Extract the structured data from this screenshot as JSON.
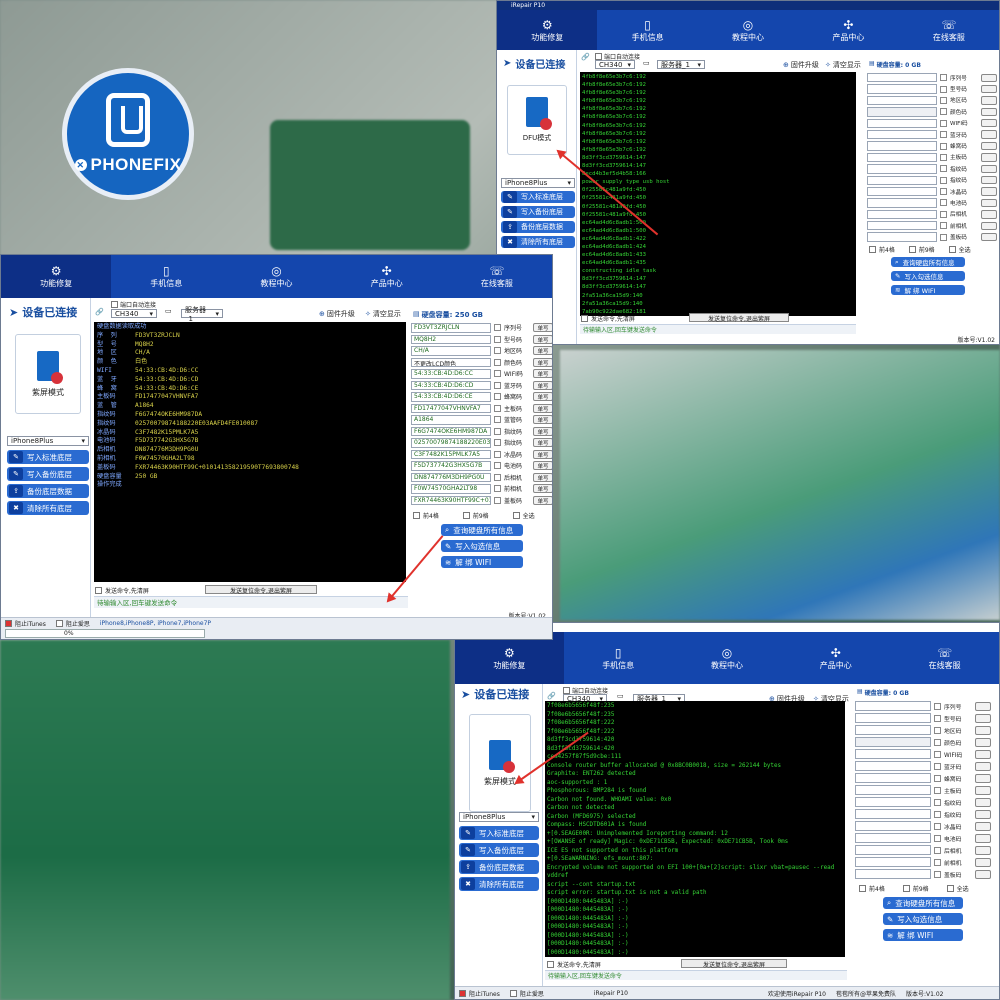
{
  "brand": {
    "logo_text": "PHONEFIX"
  },
  "colors": {
    "nav": "#1446ad",
    "console_text": "#35d435",
    "arrow": "#e0322c"
  },
  "win1": {
    "title": "iRepair P10",
    "nav": [
      "功能修复",
      "手机信息",
      "教程中心",
      "产品中心",
      "在线客服"
    ],
    "connected": "设备已连接",
    "auto_connect": "端口自动连接",
    "port": "CH340",
    "server": "服务器_1",
    "firmware_upgrade": "固件升级",
    "clear_display": "清空显示",
    "disk": "硬盘容量: 0 GB",
    "mode_label": "DFU模式",
    "model": "iPhone8Plus",
    "buttons": [
      "写入标准底层",
      "写入备份底层",
      "备份底层数据",
      "清除所有底层"
    ],
    "console": [
      "4fb8f8e65e3b7c6:192",
      "4fb8f8e65e3b7c6:192",
      "4fb8f8e65e3b7c6:192",
      "4fb8f8e65e3b7c6:192",
      "4fb8f8e65e3b7c6:192",
      "4fb8f8e65e3b7c6:192",
      "4fb8f8e65e3b7c6:192",
      "4fb8f8e65e3b7c6:192",
      "4fb8f8e65e3b7c6:192",
      "4fb8f8e65e3b7c6:192",
      "8d3ff3cd3759614:147",
      "8d3ff3cd3759614:147",
      "8ecd4b3ef5d4b58:166",
      "power supply type usb host",
      "0f25581c481a9fd:450",
      "0f25581c481a9fd:450",
      "0f25581c481a9fd:450",
      "0f25581c481a9fd:450",
      "ec64ad4d6c8adb1:500",
      "ec64ad4d6c8adb1:500",
      "ec64ad4d6c8adb1:422",
      "ec64ad4d6c8adb1:424",
      "ec64ad4d6c8adb1:433",
      "ec64ad4d6c8adb1:435",
      "constructing idle task",
      "8d3ff3cd3759614:147",
      "8d3ff3cd3759614:147",
      "2fa51a36ca15d9:140",
      "2fa51a36ca15d9:140",
      "7ab90c922dae682:181"
    ],
    "send_option": "发送命令,先清屏",
    "send_btn": "发送复位命令,退出紫屏",
    "status": "待输输入区,回车键发送命令",
    "right_labels": [
      "序列号",
      "型号码",
      "地区码",
      "颜色码",
      "WIFI码",
      "蓝牙码",
      "蜂窝码",
      "主板码",
      "指纹码",
      "指纹码",
      "冰晶码",
      "电池码",
      "后相机",
      "前相机",
      "盖板码"
    ],
    "opts": [
      "前4格",
      "前9格",
      "全选"
    ],
    "big_buttons": [
      "查询硬盘所有信息",
      "写入勾选信息",
      "解 绑 WIFI"
    ],
    "version": "版本号:V1.02"
  },
  "win2": {
    "nav": [
      "功能修复",
      "手机信息",
      "教程中心",
      "产品中心",
      "在线客服"
    ],
    "connected": "设备已连接",
    "auto_connect": "端口自动连接",
    "port": "CH340",
    "server": "服务器_1",
    "firmware_upgrade": "固件升级",
    "clear_display": "清空显示",
    "disk": "硬盘容量: 250 GB",
    "mode_label": "紫屏模式",
    "model": "iPhone8Plus",
    "buttons": [
      "写入标准底层",
      "写入备份底层",
      "备份底层数据",
      "清除所有底层"
    ],
    "console_head": "硬盘数据读取成功",
    "info_keys": [
      "序  列",
      "型  号",
      "地  区",
      "颜  色",
      "WIFI",
      "蓝  牙",
      "蜂  窝",
      "主板码",
      "蓝  管",
      "指纹码",
      "指纹码",
      "冰晶码",
      "电池码",
      "后相机",
      "前相机",
      "盖板码",
      "硬盘容量"
    ],
    "info_vals": [
      "FD3VT3ZRJCLN",
      "MQ8H2",
      "CH/A",
      "白色",
      "54:33:CB:4D:D6:CC",
      "54:33:CB:4D:D6:CD",
      "54:33:CB:4D:D6:CE",
      "FD17477047VHNVFA7",
      "A1864",
      "F6G7474OKE6HM987DA",
      "02570079874188220E03AAFD4FE010087",
      "C3F7482K15PMLK7A5",
      "F5D737742G3HX5G7B",
      "DN874776M3DH9PG0U",
      "F0W74570GHA2LT98",
      "FXR74463K90HTF99C+010141358219590T7693800748",
      "250 GB"
    ],
    "console_foot": "操作完成",
    "right_vals": [
      "FD3VT3ZRJCLN",
      "MQ8H2",
      "CH/A",
      "不更改LCD颜色",
      "54:33:CB:4D:D6:CC",
      "54:33:CB:4D:D6:CD",
      "54:33:CB:4D:D6:CE",
      "FD17477047VHNVFA7",
      "A1864",
      "F6G7474OKE6HM987DA",
      "02570079874188220E03AA",
      "C3F7482K15PMLK7A5",
      "F5D737742G3HX5G7B",
      "DN874776M3DH9PG0U",
      "F0W74570GHA2LT98",
      "FXR74463K90HTF99C+01C"
    ],
    "right_labels": [
      "序列号",
      "型号码",
      "地区码",
      "颜色码",
      "WIFI码",
      "蓝牙码",
      "蜂窝码",
      "主板码",
      "蓝管码",
      "指纹码",
      "指纹码",
      "冰晶码",
      "电池码",
      "后相机",
      "前相机",
      "盖板码"
    ],
    "write_btn": "单写",
    "opts": [
      "前4格",
      "前9格",
      "全选"
    ],
    "big_buttons": [
      "查询硬盘所有信息",
      "写入勾选信息",
      "解 绑 WIFI"
    ],
    "send_option": "发送命令,先清屏",
    "send_btn": "发送复位命令,退出紫屏",
    "status": "待输输入区,回车键发送命令",
    "version": "版本号:V1.02",
    "bottom": {
      "itunes": "阻止iTunes",
      "anti": "阻止爱思",
      "models": "iPhone8,iPhone8P, iPhone7,iPhone7P",
      "progress": "0%"
    }
  },
  "win3": {
    "nav": [
      "功能修复",
      "手机信息",
      "教程中心",
      "产品中心",
      "在线客服"
    ],
    "connected": "设备已连接",
    "auto_connect": "端口自动连接",
    "port": "CH340",
    "server": "服务器_1",
    "firmware_upgrade": "固件升级",
    "clear_display": "清空显示",
    "disk": "硬盘容量: 0 GB",
    "mode_label": "紫屏模式",
    "model": "iPhone8Plus",
    "buttons": [
      "写入标准底层",
      "写入备份底层",
      "备份底层数据",
      "清除所有底层"
    ],
    "console": [
      "7f08e6b5656f48f:235",
      "7f08e6b5656f48f:235",
      "7f08e6b5656f48f:222",
      "7f08e6b5656f48f:222",
      "8d3ff3cd3759614:420",
      "8d3ff3cd3759614:420",
      "cea4257f87f5d9cbe:111",
      "Console router buffer allocated @ 0x8BC0B0018, size = 262144 bytes",
      "Graphite: ENT262 detected",
      "aoc-supported : 1",
      "Phosphorous: BMP284 is found",
      "Carbon not found. WHOAMI value: 0x0",
      "Carbon not detected",
      "Carbon (MFD6975) selected",
      "Compass: HSCDTD601A is found",
      "+[0.SEAGE00R: Unimplemented Ioreporting command: 12",
      "+[OWANSE of ready] Magic: 0xDE71CB5B, Expected: 0xDE71CB5B, Took 0ms",
      "ICE ES not supported on this platform",
      "+[0.SEaWARNING: efs_mount:807:",
      "Encrypted volume not supported on EFI 100+[0a+[2]script: slixr vbat=pausec --read",
      "vddref",
      "script --cont startup.txt",
      "script error: startup.txt is not a valid path",
      "[000D1480:0445483A] :-)",
      "[000D1480:0445483A] :-)",
      "[000D1480:0445483A] :-)",
      "[000D1480:0445483A] :-)",
      "[000D1480:0445483A] :-)",
      "[000D1480:0445483A] :-)",
      "[000D1480:0445483A] :-)"
    ],
    "send_option": "发送命令,先清屏",
    "send_btn": "发送复位命令,退出紫屏",
    "status": "待输输入区,回车键发送命令",
    "right_labels": [
      "序列号",
      "型号码",
      "地区码",
      "颜色码",
      "WIFI码",
      "蓝牙码",
      "蜂窝码",
      "主板码",
      "指纹码",
      "指纹码",
      "冰晶码",
      "电池码",
      "后相机",
      "前相机",
      "盖板码"
    ],
    "opts": [
      "前4格",
      "前9格",
      "全选"
    ],
    "big_buttons": [
      "查询硬盘所有信息",
      "写入勾选信息",
      "解 绑 WIFI"
    ],
    "bottom": {
      "itunes": "阻止iTunes",
      "anti": "阻止爱思",
      "app": "iRepair P10",
      "welcome": "欢迎使用iRepair P10",
      "copyright": "苞苞所有@苹果免费队",
      "version": "版本号:V1.02"
    }
  }
}
